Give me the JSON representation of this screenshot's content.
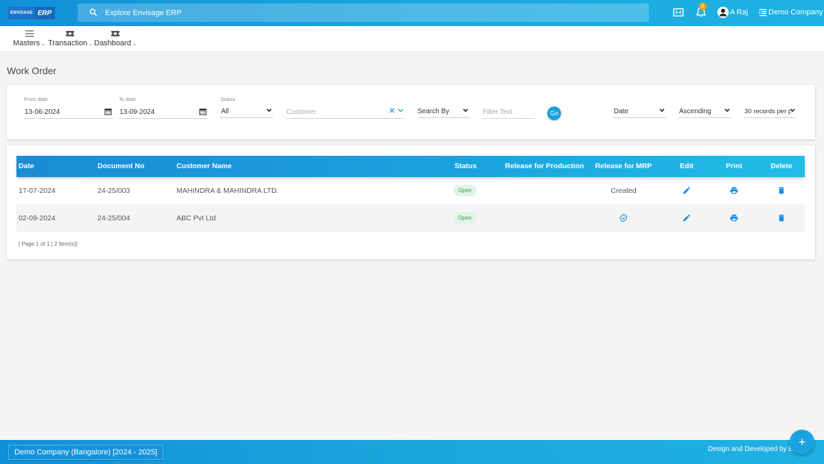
{
  "app": {
    "logo_text_small": "ENVISAGE",
    "logo_text_large": "ERP",
    "search_placeholder": "Explore Envisage ERP",
    "notifications_count": "5",
    "user_name": "A Raj",
    "company_name": "Demo Company"
  },
  "menu": {
    "items": [
      {
        "label": "Masters",
        "icon": "hamburger-icon"
      },
      {
        "label": "Transaction",
        "icon": "ticket-icon"
      },
      {
        "label": "Dashboard",
        "icon": "ticket-icon"
      }
    ]
  },
  "page": {
    "title": "Work Order"
  },
  "filters": {
    "from_date_label": "From date",
    "from_date_value": "13-06-2024",
    "to_date_label": "To date",
    "to_date_value": "13-09-2024",
    "status_label": "Status",
    "status_value": "All",
    "customer_placeholder": "Customer",
    "search_by_value": "Search By",
    "filter_text_placeholder": "Filter Text",
    "go_label": "Go",
    "sort_field_value": "Date",
    "sort_order_value": "Ascending",
    "page_size_value": "30 records per p"
  },
  "table": {
    "columns": [
      "Date",
      "Document No",
      "Customer Name",
      "Status",
      "Release for Production",
      "Release for MRP",
      "Edit",
      "Print",
      "Delete"
    ],
    "rows": [
      {
        "date": "17-07-2024",
        "doc_no": "24-25/003",
        "customer": "MAHINDRA & MAHINDRA LTD.",
        "status": "Open",
        "release_production": "",
        "release_mrp": "Created"
      },
      {
        "date": "02-09-2024",
        "doc_no": "24-25/004",
        "customer": "ABC Pvt Ltd",
        "status": "Open",
        "release_production": "",
        "release_mrp": ""
      }
    ],
    "pager_text": "[ Page 1 of 1 | 2 Item(s)]"
  },
  "footer": {
    "financial_year_label": "Demo Company (Bangalore) [2024 - 2025]",
    "credit_text": "Design and Developed by EN"
  },
  "colors": {
    "primary": "#1ba2de",
    "open_badge_bg": "#e2f4e8",
    "open_badge_text": "#2f9a55",
    "notification_badge": "#f7a21b"
  }
}
